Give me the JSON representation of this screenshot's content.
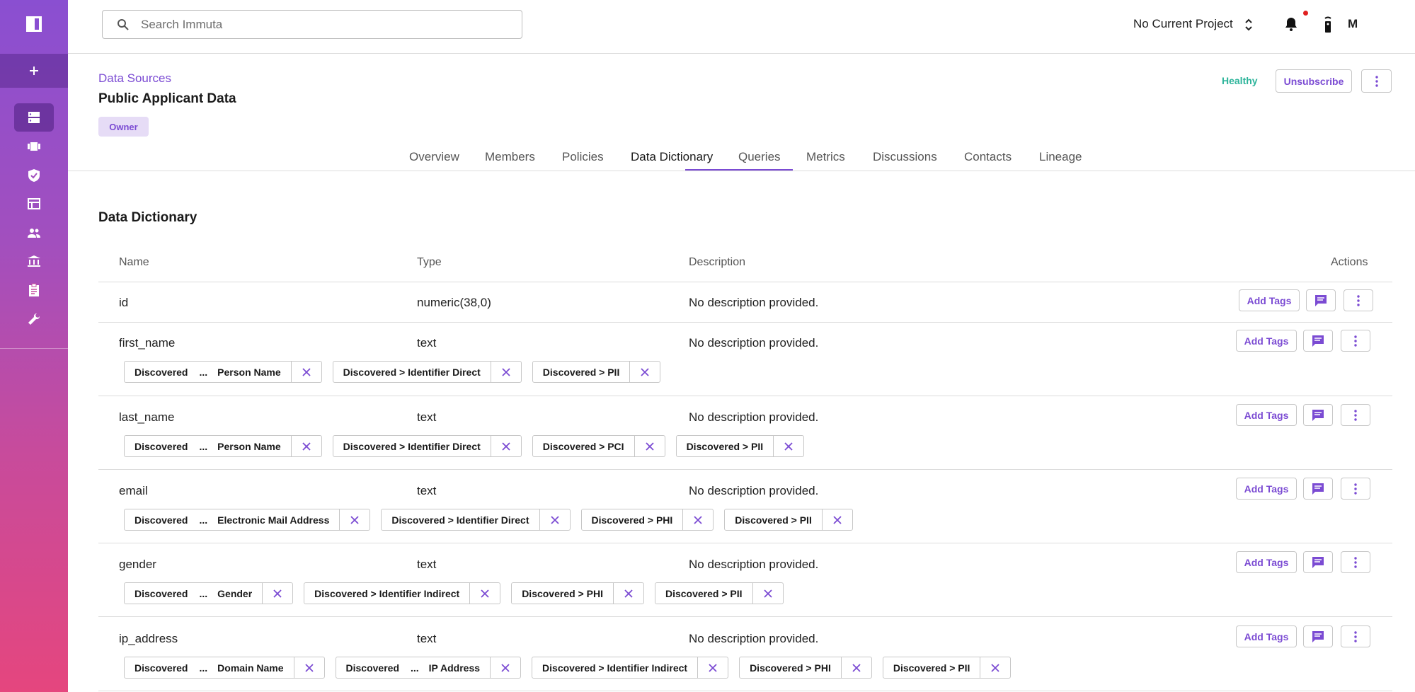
{
  "search": {
    "placeholder": "Search Immuta"
  },
  "topbar": {
    "project": "No Current Project",
    "avatar": "M"
  },
  "header": {
    "breadcrumb": "Data Sources",
    "title": "Public Applicant Data",
    "role_badge": "Owner",
    "health": "Healthy",
    "unsubscribe_label": "Unsubscribe"
  },
  "tabs": [
    {
      "label": "Overview"
    },
    {
      "label": "Members"
    },
    {
      "label": "Policies"
    },
    {
      "label": "Data Dictionary"
    },
    {
      "label": "Queries"
    },
    {
      "label": "Metrics"
    },
    {
      "label": "Discussions"
    },
    {
      "label": "Contacts"
    },
    {
      "label": "Lineage"
    }
  ],
  "active_tab": "Data Dictionary",
  "dictionary": {
    "title": "Data Dictionary",
    "columns": {
      "name": "Name",
      "type": "Type",
      "description": "Description",
      "actions": "Actions"
    },
    "add_tags_label": "Add Tags",
    "rows": [
      {
        "name": "id",
        "type": "numeric(38,0)",
        "description": "No description provided.",
        "tags": []
      },
      {
        "name": "first_name",
        "type": "text",
        "description": "No description provided.",
        "tags": [
          {
            "prefix": "Discovered",
            "ellipsis": "...",
            "leaf": "Person Name"
          },
          {
            "label": "Discovered > Identifier Direct"
          },
          {
            "label": "Discovered > PII"
          }
        ]
      },
      {
        "name": "last_name",
        "type": "text",
        "description": "No description provided.",
        "tags": [
          {
            "prefix": "Discovered",
            "ellipsis": "...",
            "leaf": "Person Name"
          },
          {
            "label": "Discovered > Identifier Direct"
          },
          {
            "label": "Discovered > PCI"
          },
          {
            "label": "Discovered > PII"
          }
        ]
      },
      {
        "name": "email",
        "type": "text",
        "description": "No description provided.",
        "tags": [
          {
            "prefix": "Discovered",
            "ellipsis": "...",
            "leaf": "Electronic Mail Address"
          },
          {
            "label": "Discovered > Identifier Direct"
          },
          {
            "label": "Discovered > PHI"
          },
          {
            "label": "Discovered > PII"
          }
        ]
      },
      {
        "name": "gender",
        "type": "text",
        "description": "No description provided.",
        "tags": [
          {
            "prefix": "Discovered",
            "ellipsis": "...",
            "leaf": "Gender"
          },
          {
            "label": "Discovered > Identifier Indirect"
          },
          {
            "label": "Discovered > PHI"
          },
          {
            "label": "Discovered > PII"
          }
        ]
      },
      {
        "name": "ip_address",
        "type": "text",
        "description": "No description provided.",
        "tags": [
          {
            "prefix": "Discovered",
            "ellipsis": "...",
            "leaf": "Domain Name"
          },
          {
            "prefix": "Discovered",
            "ellipsis": "...",
            "leaf": "IP Address"
          },
          {
            "label": "Discovered > Identifier Indirect"
          },
          {
            "label": "Discovered > PHI"
          },
          {
            "label": "Discovered > PII"
          }
        ]
      }
    ]
  },
  "colors": {
    "accent": "#7b4bd3",
    "healthy": "#2cb49a",
    "notification": "#e02020"
  },
  "icons": {
    "sidebar": [
      "logo-icon",
      "add-icon",
      "data-sources-icon",
      "projects-icon",
      "policies-icon",
      "query-editor-icon",
      "people-icon",
      "governance-icon",
      "audit-icon",
      "tools-icon"
    ],
    "topbar": [
      "search-icon",
      "unfold-icon",
      "bell-icon",
      "remote-icon"
    ],
    "row_actions": [
      "comment-icon",
      "more-vert-icon"
    ],
    "tag": "close-icon"
  }
}
